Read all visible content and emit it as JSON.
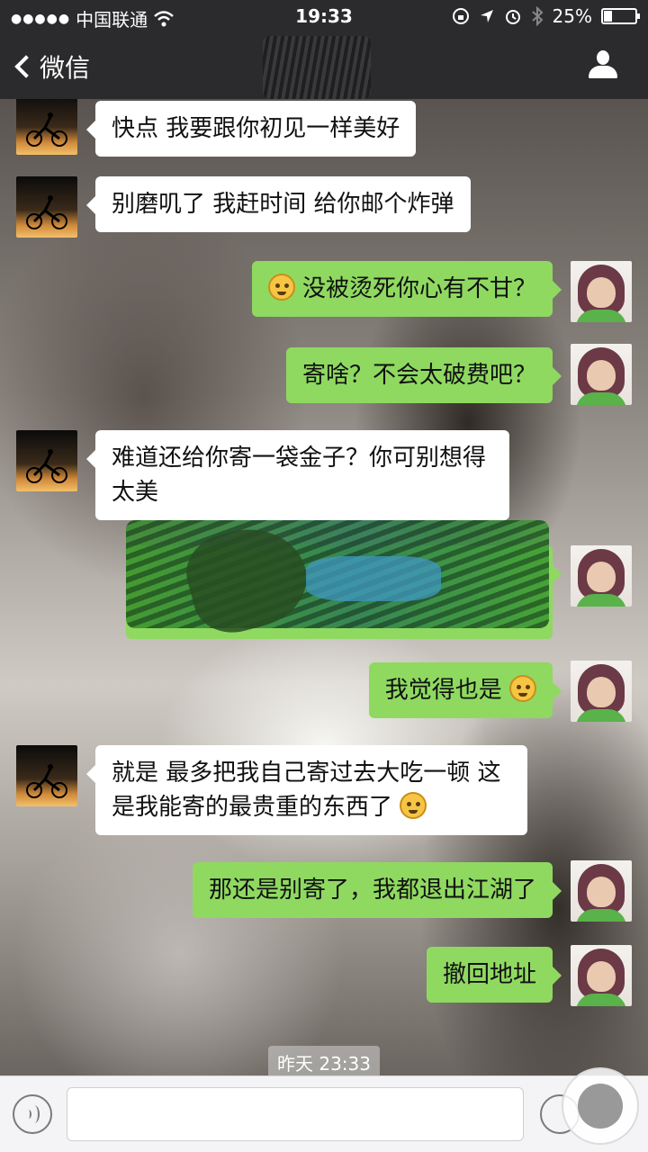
{
  "status_bar": {
    "signal_dots": "●●●●●",
    "carrier": "中国联通",
    "time": "19:33",
    "battery_text": "25%",
    "battery_level": 0.25
  },
  "nav": {
    "back_label": "微信"
  },
  "messages": [
    {
      "side": "in",
      "text": "快点  我要跟你初见一样美好"
    },
    {
      "side": "in",
      "text": "别磨叽了  我赶时间  给你邮个炸弹"
    },
    {
      "side": "out",
      "emoji": "smirk-emoji",
      "text": "没被烫死你心有不甘？"
    },
    {
      "side": "out",
      "text": "寄啥？不会太破费吧？"
    },
    {
      "side": "in",
      "text": "难道还给你寄一袋金子？你可别想得太美"
    },
    {
      "side": "out",
      "text": "",
      "redacted": true
    },
    {
      "side": "out",
      "text": "我觉得也是",
      "emoji": "dazed-emoji"
    },
    {
      "side": "in",
      "text": "就是  最多把我自己寄过去大吃一顿  这是我能寄的最贵重的东西了",
      "emoji": "grimace-emoji"
    },
    {
      "side": "out",
      "text": "那还是别寄了，我都退出江湖了"
    },
    {
      "side": "out",
      "text": "撤回地址"
    }
  ],
  "timestamp": "昨天 23:33",
  "colors": {
    "bar_dark": "#2b2b2d",
    "bubble_out": "#8fd961",
    "bubble_in": "#ffffff"
  }
}
